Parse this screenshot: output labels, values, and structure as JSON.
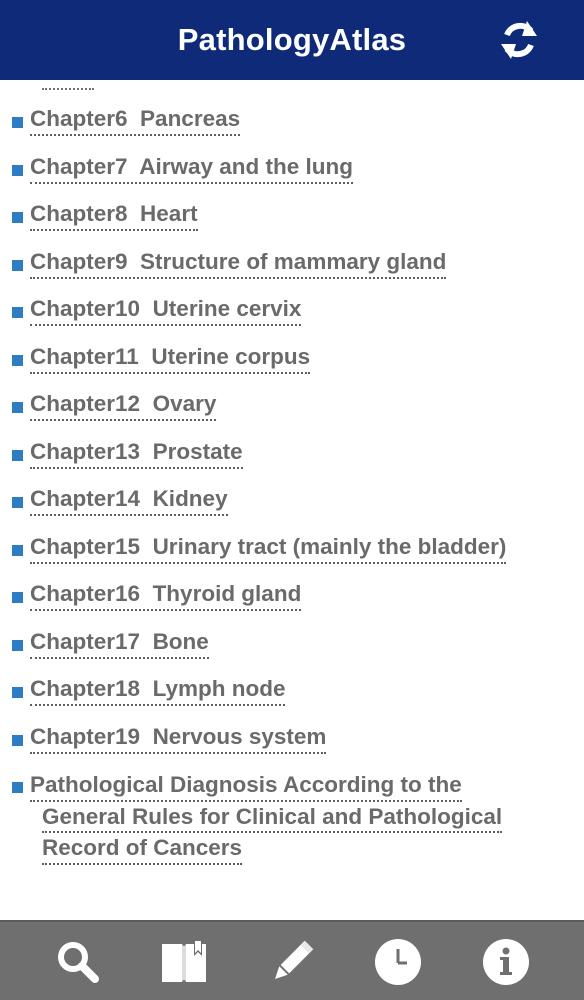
{
  "header": {
    "title": "PathologyAtlas",
    "refresh_icon": "refresh-icon"
  },
  "chapters": [
    {
      "number": "Chapter6",
      "title": "Pancreas"
    },
    {
      "number": "Chapter7",
      "title": "Airway and the lung"
    },
    {
      "number": "Chapter8",
      "title": "Heart"
    },
    {
      "number": "Chapter9",
      "title": "Structure of mammary gland"
    },
    {
      "number": "Chapter10",
      "title": "Uterine cervix"
    },
    {
      "number": "Chapter11",
      "title": "Uterine corpus"
    },
    {
      "number": "Chapter12",
      "title": "Ovary"
    },
    {
      "number": "Chapter13",
      "title": "Prostate"
    },
    {
      "number": "Chapter14",
      "title": "Kidney"
    },
    {
      "number": "Chapter15",
      "title": "Urinary tract (mainly the bladder)"
    },
    {
      "number": "Chapter16",
      "title": "Thyroid gland"
    },
    {
      "number": "Chapter17",
      "title": "Bone"
    },
    {
      "number": "Chapter18",
      "title": "Lymph node"
    },
    {
      "number": "Chapter19",
      "title": "Nervous system"
    }
  ],
  "appendix": {
    "lines": [
      "Pathological Diagnosis According to the",
      "General Rules for Clinical and Pathological",
      "Record of Cancers"
    ]
  },
  "tabbar": {
    "items": [
      {
        "icon": "search-icon"
      },
      {
        "icon": "bookmark-book-icon"
      },
      {
        "icon": "pencil-icon"
      },
      {
        "icon": "history-clock-icon"
      },
      {
        "icon": "info-icon"
      }
    ]
  },
  "colors": {
    "header_bg": "#0e2a78",
    "bullet": "#2d7dc2",
    "link_text": "#6a6a6a",
    "tabbar_bg": "#6f6f6f"
  }
}
